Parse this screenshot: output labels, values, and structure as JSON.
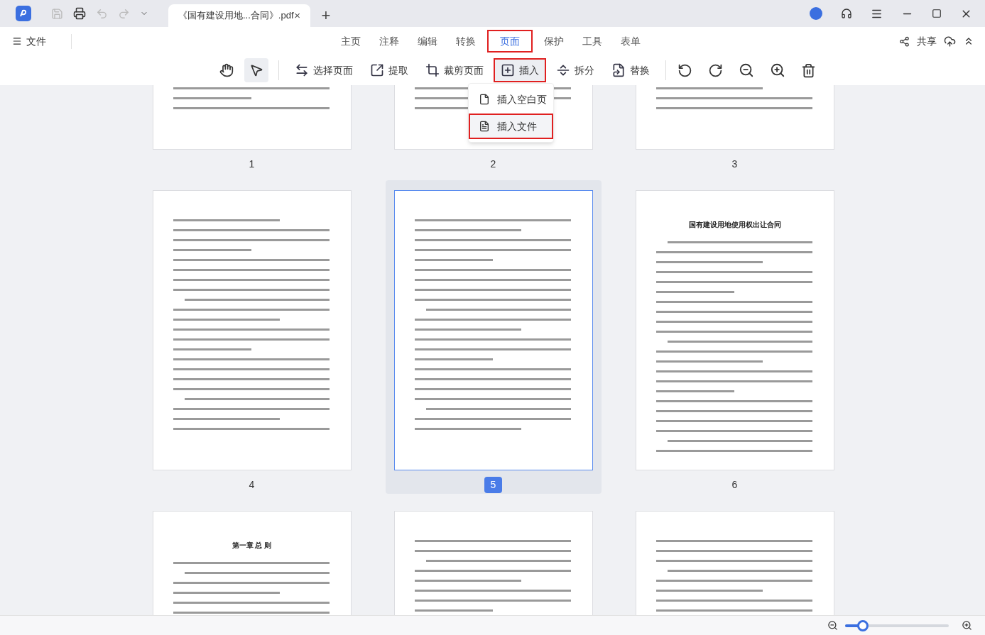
{
  "title_bar": {
    "document_tab": {
      "title": "《国有建设用地...合同》.pdf",
      "close": "×"
    },
    "new_tab": "+"
  },
  "menu": {
    "file": "文件",
    "tabs": [
      {
        "label": "主页",
        "selected": false,
        "annotated": false
      },
      {
        "label": "注释",
        "selected": false,
        "annotated": false
      },
      {
        "label": "编辑",
        "selected": false,
        "annotated": false
      },
      {
        "label": "转换",
        "selected": false,
        "annotated": false
      },
      {
        "label": "页面",
        "selected": true,
        "annotated": true
      },
      {
        "label": "保护",
        "selected": false,
        "annotated": false
      },
      {
        "label": "工具",
        "selected": false,
        "annotated": false
      },
      {
        "label": "表单",
        "selected": false,
        "annotated": false
      }
    ],
    "share": "共享"
  },
  "toolbar": {
    "pointer_tools": [
      {
        "kind": "hand",
        "selected": false
      },
      {
        "kind": "cursor",
        "selected": true
      }
    ],
    "actions": [
      {
        "kind": "select",
        "label": "选择页面",
        "active": false,
        "annotated": false
      },
      {
        "kind": "extract",
        "label": "提取",
        "active": false,
        "annotated": false
      },
      {
        "kind": "crop",
        "label": "裁剪页面",
        "active": false,
        "annotated": false
      },
      {
        "kind": "insert",
        "label": "插入",
        "active": true,
        "annotated": true
      },
      {
        "kind": "split",
        "label": "拆分",
        "active": false,
        "annotated": false
      },
      {
        "kind": "replace",
        "label": "替换",
        "active": false,
        "annotated": false
      }
    ]
  },
  "insert_menu": [
    {
      "kind": "blank",
      "label": "插入空白页",
      "annotated": false
    },
    {
      "kind": "file",
      "label": "插入文件",
      "annotated": true
    }
  ],
  "pages": [
    {
      "label": "1",
      "selected": false
    },
    {
      "label": "2",
      "selected": false
    },
    {
      "label": "3",
      "selected": false
    },
    {
      "label": "4",
      "selected": false
    },
    {
      "label": "5",
      "selected": true
    },
    {
      "label": "6",
      "selected": false,
      "heading": "国有建设用地使用权出让合同"
    },
    {
      "selected": false,
      "heading": "第一章  总  则"
    },
    {
      "selected": false
    },
    {
      "selected": false
    }
  ],
  "zoom": {
    "level": 0.17
  }
}
